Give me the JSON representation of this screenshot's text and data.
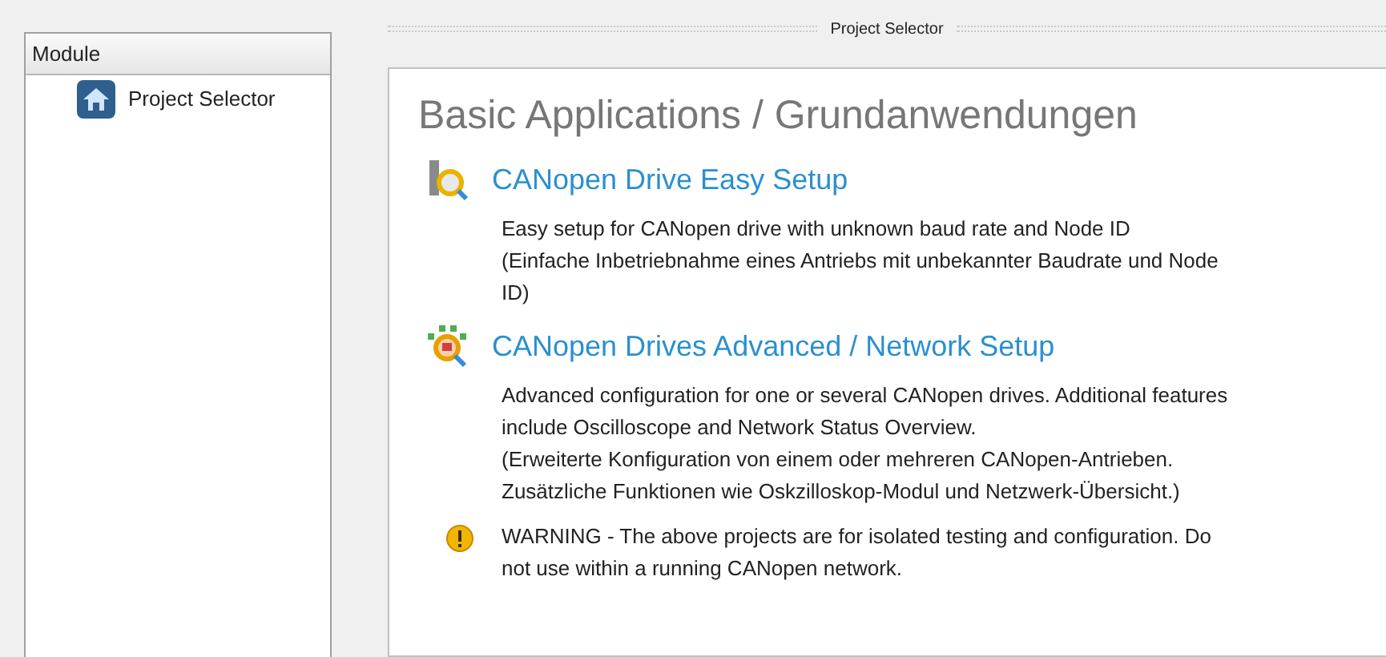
{
  "sidebar": {
    "header": "Module",
    "items": [
      {
        "label": "Project Selector",
        "selected": false
      }
    ]
  },
  "panel": {
    "title": "Project Selector",
    "heading": "Basic Applications / Grundanwendungen",
    "entries": [
      {
        "kind": "easy",
        "link": "CANopen Drive Easy Setup",
        "lines": [
          "Easy setup for CANopen drive with unknown baud rate and Node ID",
          "(Einfache Inbetriebnahme eines Antriebs mit unbekannter Baudrate und Node",
          "ID)"
        ]
      },
      {
        "kind": "network",
        "link": "CANopen Drives Advanced / Network Setup",
        "lines": [
          "Advanced configuration for one or several CANopen drives. Additional features",
          "include Oscilloscope and Network Status Overview.",
          "(Erweiterte Konfiguration von einem oder mehreren CANopen-Antrieben.",
          "Zusätzliche Funktionen wie Oskzilloskop-Modul und Netzwerk-Übersicht.)"
        ]
      },
      {
        "kind": "warning",
        "lines": [
          "WARNING - The above projects are for isolated testing and configuration. Do",
          "not use within a running CANopen network."
        ]
      }
    ]
  }
}
